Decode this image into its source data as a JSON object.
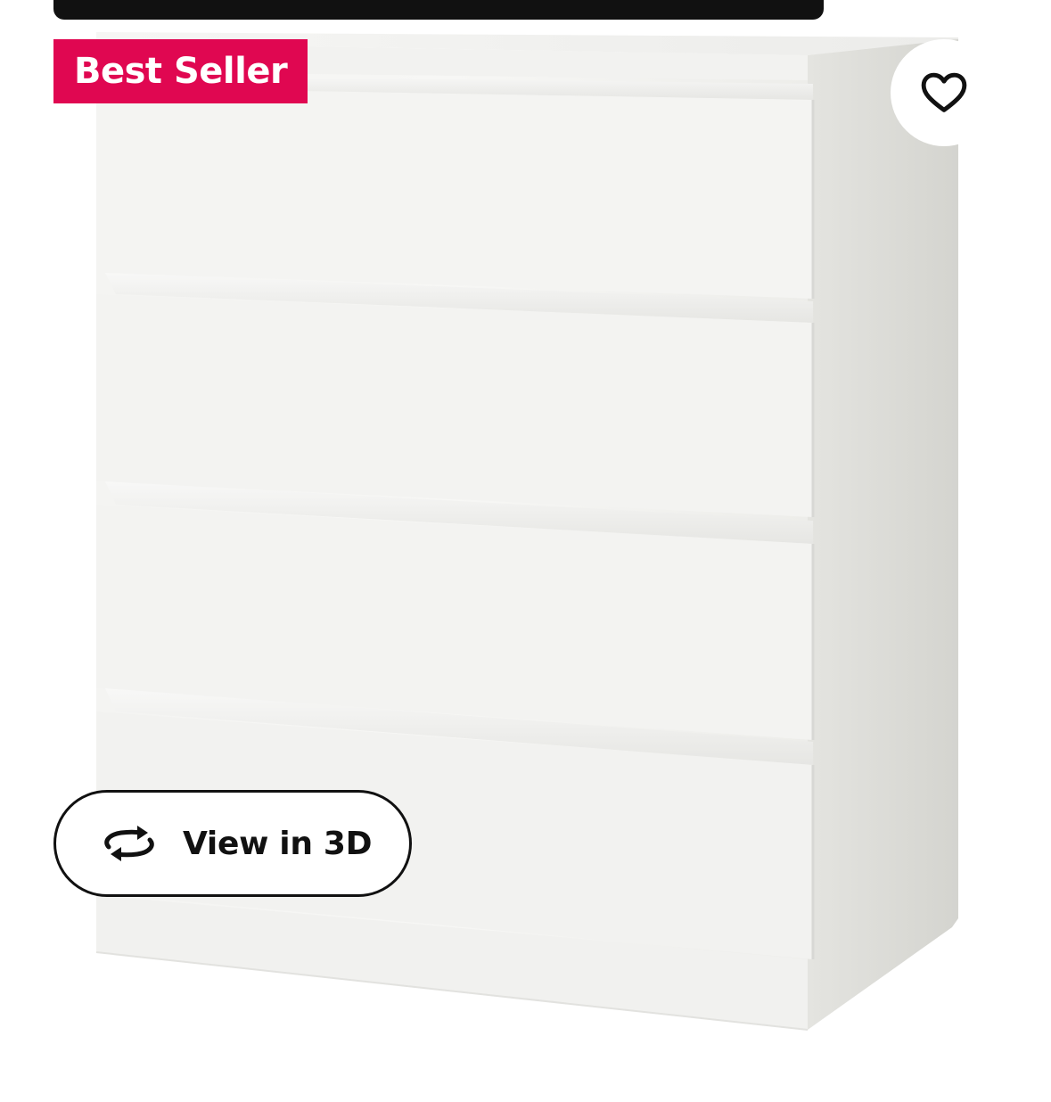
{
  "badge": {
    "label": "Best Seller"
  },
  "favorite": {
    "icon": "heart-outline-icon"
  },
  "view_3d": {
    "label": "View in 3D",
    "icon": "rotate-3d-icon"
  },
  "product_image": {
    "subject": "white four-drawer chest of drawers"
  },
  "colors": {
    "badge_bg": "#e00751",
    "text": "#111111",
    "top_bar": "#111111"
  }
}
